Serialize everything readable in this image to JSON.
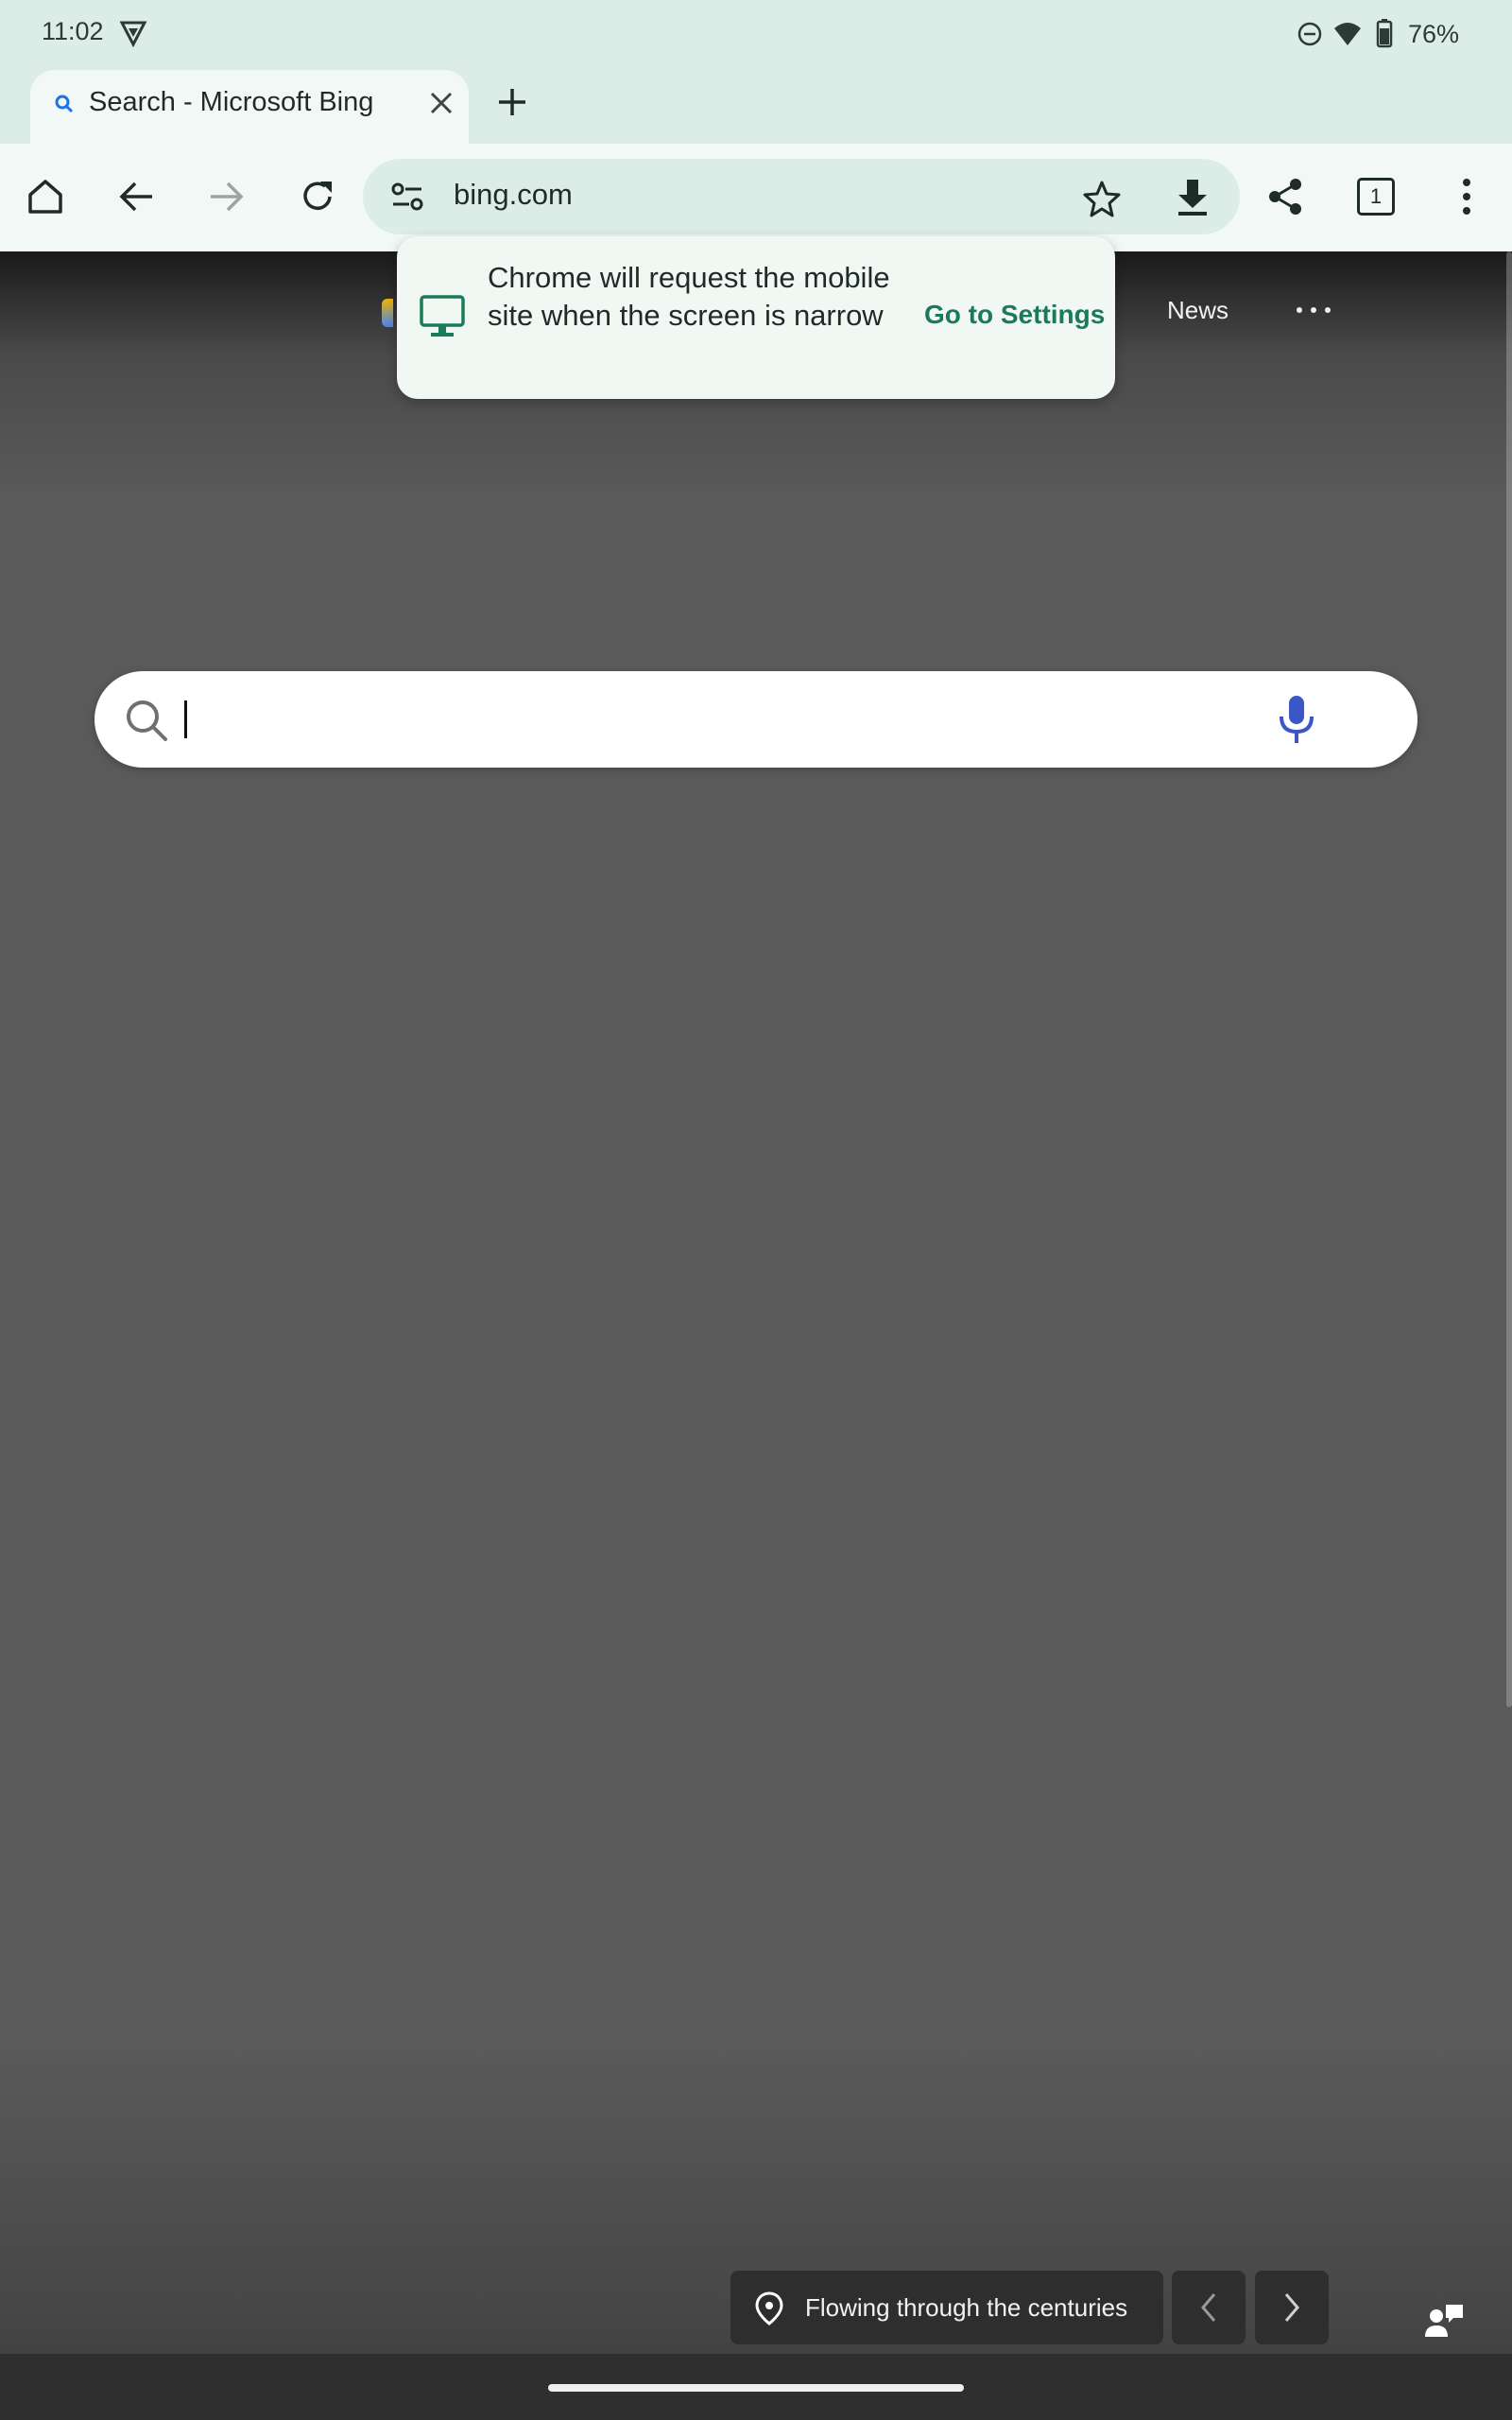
{
  "status_bar": {
    "time": "11:02",
    "battery": "76%"
  },
  "tab": {
    "title": "Search - Microsoft Bing"
  },
  "toolbar": {
    "url": "bing.com",
    "tab_count": "1"
  },
  "popup": {
    "message": "Chrome will request the mobile site when the screen is narrow",
    "action": "Go to Settings"
  },
  "bing_nav": {
    "news": "News",
    "more": "···"
  },
  "caption": {
    "text": "Flowing through the centuries"
  },
  "colors": {
    "chrome_bg": "#dcece6",
    "toolbar_bg": "#f2f8f5",
    "accent_green": "#1b7a5a",
    "mic_blue": "#3a56c8"
  },
  "icons": [
    "vpn-icon",
    "dnd-icon",
    "wifi-icon",
    "battery-icon",
    "search-tab-icon",
    "close-icon",
    "plus-icon",
    "home-icon",
    "back-icon",
    "forward-icon",
    "reload-icon",
    "site-settings-icon",
    "star-icon",
    "download-icon",
    "share-icon",
    "tab-switcher-icon",
    "more-vert-icon",
    "monitor-icon",
    "magnifier-icon",
    "mic-icon",
    "location-pin-icon",
    "chevron-left-icon",
    "chevron-right-icon",
    "chat-icon"
  ]
}
